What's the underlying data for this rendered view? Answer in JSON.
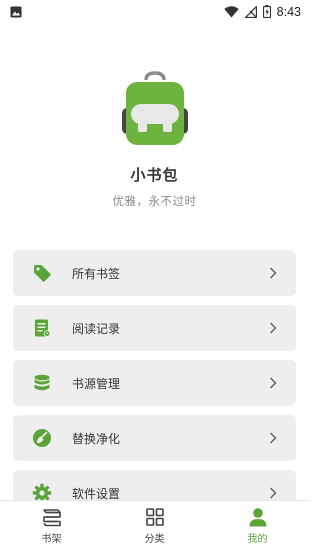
{
  "status_bar": {
    "time": "8:43"
  },
  "profile": {
    "app_name": "小书包",
    "slogan": "优雅，永不过时"
  },
  "menu": {
    "items": [
      {
        "label": "所有书签",
        "icon": "tag-icon"
      },
      {
        "label": "阅读记录",
        "icon": "reading-record-icon"
      },
      {
        "label": "书源管理",
        "icon": "database-icon"
      },
      {
        "label": "替换净化",
        "icon": "broom-icon"
      },
      {
        "label": "软件设置",
        "icon": "gear-icon"
      }
    ]
  },
  "bottom_nav": {
    "items": [
      {
        "label": "书架",
        "icon": "books-icon",
        "active": false
      },
      {
        "label": "分类",
        "icon": "grid-icon",
        "active": false
      },
      {
        "label": "我的",
        "icon": "person-icon",
        "active": true
      }
    ]
  },
  "colors": {
    "accent": "#5aa43a",
    "menu_bg": "#eeeeee",
    "text": "#333333",
    "muted": "#8a8a8a"
  }
}
